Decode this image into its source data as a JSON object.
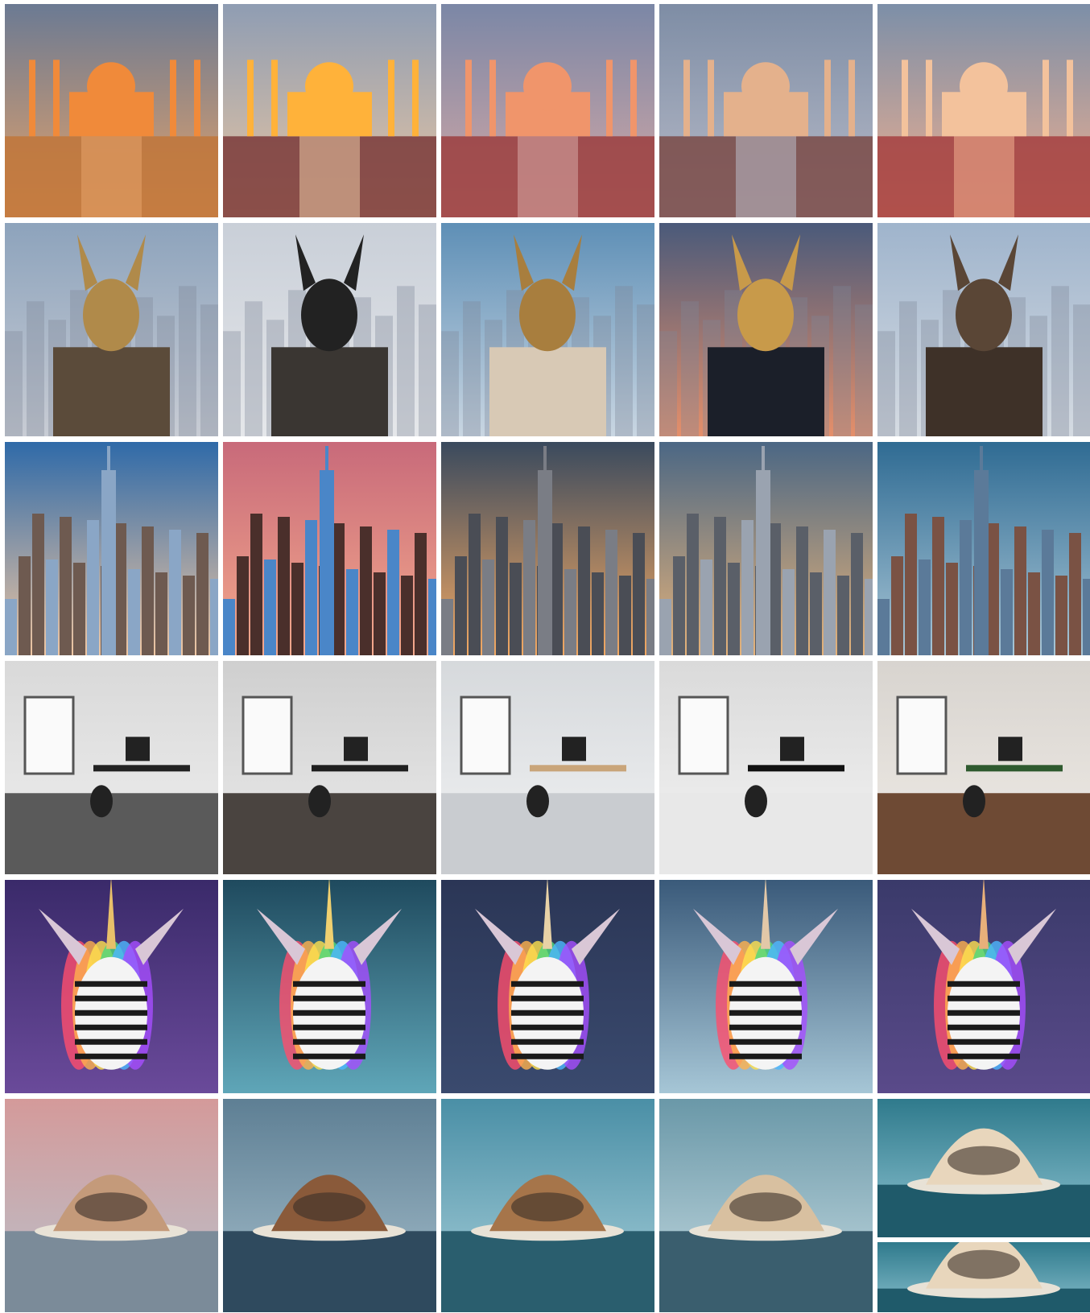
{
  "grid": {
    "rows": [
      {
        "theme": "taj-mahal",
        "tiles": [
          {
            "sky": [
              "#6b7a93",
              "#e6a36a"
            ],
            "ground": "#c0753a",
            "accent": "#f08a3a"
          },
          {
            "sky": [
              "#8f9db3",
              "#e9c6a2"
            ],
            "ground": "#7a3a3a",
            "accent": "#ffb23a"
          },
          {
            "sky": [
              "#7b87a6",
              "#d7a9a5"
            ],
            "ground": "#9b3e3e",
            "accent": "#f0956b"
          },
          {
            "sky": [
              "#7e8da5",
              "#b9bcc9"
            ],
            "ground": "#7a4a46",
            "accent": "#e4b18c"
          },
          {
            "sky": [
              "#7c8fa8",
              "#f2b08f"
            ],
            "ground": "#a54040",
            "accent": "#f3c29c"
          }
        ]
      },
      {
        "theme": "anubis-statue",
        "tiles": [
          {
            "sky": [
              "#8da3bc",
              "#c8ccd4"
            ],
            "ground": "#5b4b3a",
            "accent": "#b08a4a"
          },
          {
            "sky": [
              "#c9cfd8",
              "#e5e7ea"
            ],
            "ground": "#3a3632",
            "accent": "#222222"
          },
          {
            "sky": [
              "#5e8fb6",
              "#c9d6e2"
            ],
            "ground": "#d8c9b5",
            "accent": "#a87e3e"
          },
          {
            "sky": [
              "#4a5a7a",
              "#e58f6a"
            ],
            "ground": "#1b1f29",
            "accent": "#c89a4a"
          },
          {
            "sky": [
              "#9fb4cc",
              "#d5dbe2"
            ],
            "ground": "#3e3128",
            "accent": "#5a4636"
          }
        ]
      },
      {
        "theme": "new-york-skyline",
        "tiles": [
          {
            "sky": [
              "#2f6aa8",
              "#f0c7a3"
            ],
            "ground": "#6e5a50",
            "accent": "#8aa6c6"
          },
          {
            "sky": [
              "#c86a7a",
              "#f4a98c"
            ],
            "ground": "#4a2f2b",
            "accent": "#4a86c8"
          },
          {
            "sky": [
              "#3a4a5e",
              "#f3a963"
            ],
            "ground": "#4a4d55",
            "accent": "#7a7d85"
          },
          {
            "sky": [
              "#4b6784",
              "#e6b37a"
            ],
            "ground": "#5a5f68",
            "accent": "#9aa3b0"
          },
          {
            "sky": [
              "#2f6b93",
              "#a9c6d6"
            ],
            "ground": "#7a5244",
            "accent": "#5b7a99"
          }
        ]
      },
      {
        "theme": "office-interior",
        "tiles": [
          {
            "sky": [
              "#d9d9d9",
              "#efefef"
            ],
            "ground": "#5a5a5a",
            "accent": "#222222"
          },
          {
            "sky": [
              "#cfcfcf",
              "#ececec"
            ],
            "ground": "#4a4440",
            "accent": "#1f1f1f"
          },
          {
            "sky": [
              "#d6d9dc",
              "#f2f3f4"
            ],
            "ground": "#c9ccd0",
            "accent": "#c9a57a"
          },
          {
            "sky": [
              "#dadada",
              "#f4f4f4"
            ],
            "ground": "#e8e8e8",
            "accent": "#111111"
          },
          {
            "sky": [
              "#d8d4cf",
              "#f0ece7"
            ],
            "ground": "#6e4a34",
            "accent": "#2f5a2f"
          }
        ]
      },
      {
        "theme": "zebra-unicorn",
        "tiles": [
          {
            "sky": [
              "#3a2a6a",
              "#6a4a9a"
            ],
            "ground": "#1a1a1a",
            "accent": "#e8c06a"
          },
          {
            "sky": [
              "#1f4a5e",
              "#5fa6b8"
            ],
            "ground": "#1a1a1a",
            "accent": "#f0d070"
          },
          {
            "sky": [
              "#2b3656",
              "#3a4a6e"
            ],
            "ground": "#1a1a1a",
            "accent": "#e8d2a6"
          },
          {
            "sky": [
              "#3a5a7a",
              "#a6c6d6"
            ],
            "ground": "#1a1a1a",
            "accent": "#e2c8a8"
          },
          {
            "sky": [
              "#3a3a6a",
              "#5a4a8a"
            ],
            "ground": "#1a1a1a",
            "accent": "#e8b07a"
          }
        ]
      },
      {
        "theme": "futuristic-floating-architecture",
        "tiles": [
          {
            "sky": [
              "#d49a9a",
              "#b9c2cc"
            ],
            "ground": "#7b8b99",
            "accent": "#c49a7a"
          },
          {
            "sky": [
              "#5e7f94",
              "#a6bfcc"
            ],
            "ground": "#2f4a5e",
            "accent": "#8a5a3a"
          },
          {
            "sky": [
              "#4a8fa6",
              "#a9d0da"
            ],
            "ground": "#2a5e6e",
            "accent": "#a6754a"
          },
          {
            "sky": [
              "#6a98a8",
              "#c6dbe2"
            ],
            "ground": "#3a5e6e",
            "accent": "#d8c0a0"
          },
          {
            "sky": [
              "#2f7a8c",
              "#8ec4d2"
            ],
            "ground": "#1f5a6a",
            "accent": "#e8d6bc"
          }
        ]
      }
    ]
  }
}
